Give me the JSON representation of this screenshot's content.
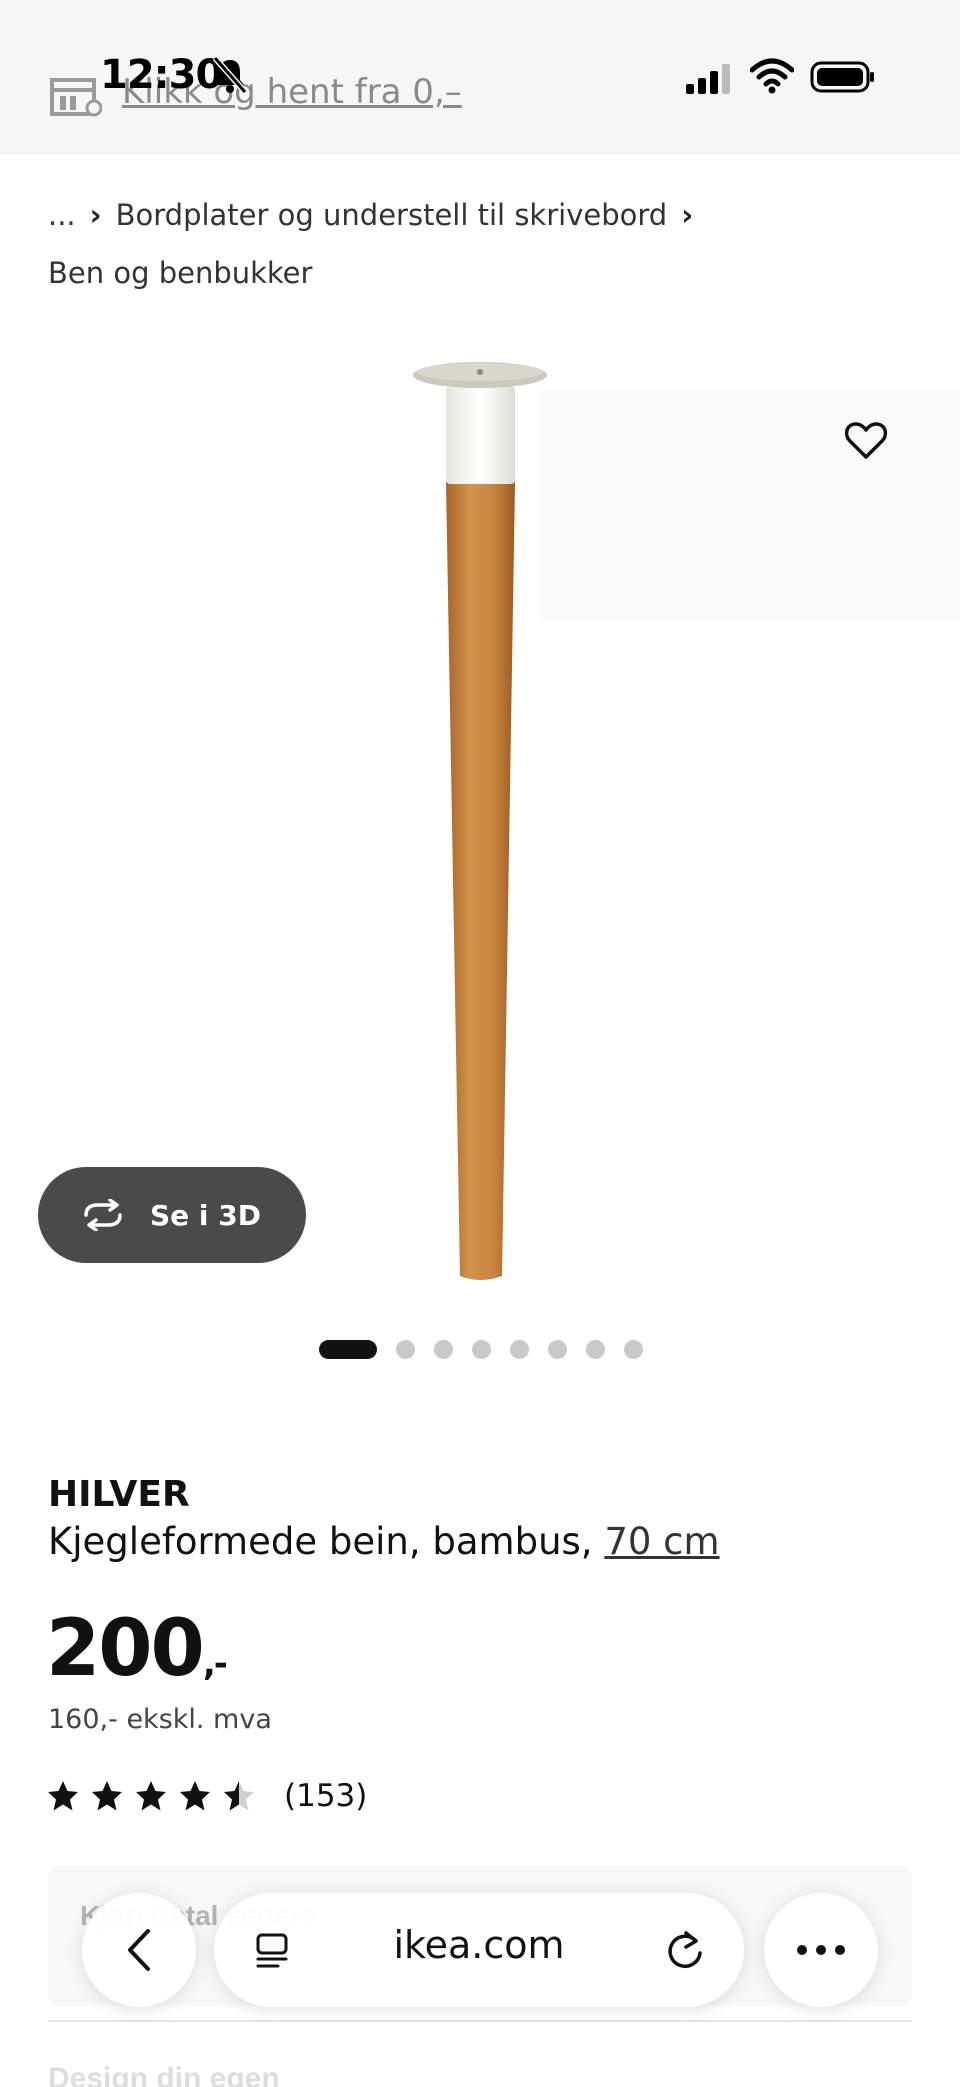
{
  "status_bar": {
    "time": "12:30",
    "bell_icon": "bell-slash-icon",
    "signal_icon": "cellular-signal-icon",
    "wifi_icon": "wifi-icon",
    "battery_icon": "battery-icon"
  },
  "banner": {
    "icon": "store-icon",
    "link_text": "Klikk og hent fra 0,–"
  },
  "breadcrumb": {
    "items": [
      "...",
      "Bordplater og understell til skrivebord",
      "Ben og benbukker"
    ],
    "separator": "›"
  },
  "gallery": {
    "favorite_icon": "heart-icon",
    "see_3d_icon": "rotate-3d-icon",
    "see_3d_label": "Se i 3D",
    "dot_count": 8,
    "active_index": 0
  },
  "product": {
    "name": "HILVER",
    "description": "Kjegleformede bein, bambus,",
    "size": "70 cm",
    "price": "200",
    "price_suffix": ",-",
    "price_ex_vat": "160,- ekskl. mva",
    "rating": 4.5,
    "review_count": "(153)"
  },
  "purchase_options": {
    "text": "Kjøp   Betal senere"
  },
  "safari": {
    "back_icon": "chevron-left-icon",
    "tabs_icon": "tabs-icon",
    "url": "ikea.com",
    "reload_icon": "reload-icon",
    "more_icon": "ellipsis-icon"
  },
  "next_section": {
    "heading": "Design din egen"
  },
  "colors": {
    "pill_dark": "#4a4a4a",
    "bamboo": "#c8843e",
    "dot_active": "#111111",
    "dot_inactive": "#c9c9c9"
  }
}
